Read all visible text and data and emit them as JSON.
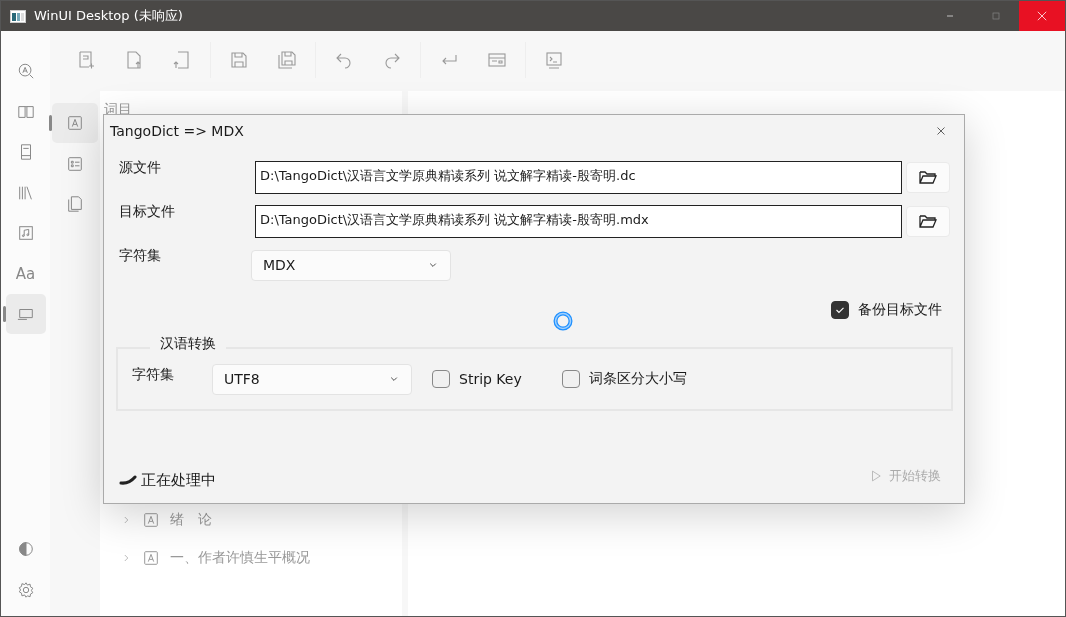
{
  "window": {
    "title": "WinUI Desktop (未响应)"
  },
  "rail": {
    "top": [
      {
        "kind": "search",
        "selected": false
      },
      {
        "kind": "book",
        "selected": false
      },
      {
        "kind": "notebook",
        "selected": false
      },
      {
        "kind": "library",
        "selected": false
      },
      {
        "kind": "music",
        "selected": false
      },
      {
        "kind": "text",
        "label": "Aa",
        "selected": false
      },
      {
        "kind": "device",
        "selected": true
      }
    ],
    "bottom": [
      {
        "kind": "contrast"
      },
      {
        "kind": "settings"
      }
    ]
  },
  "subrail": [
    {
      "kind": "letter",
      "selected": true
    },
    {
      "kind": "list",
      "selected": false
    },
    {
      "kind": "copy",
      "selected": false
    }
  ],
  "toolbar": [
    [
      {
        "kind": "new"
      },
      {
        "kind": "export"
      },
      {
        "kind": "import"
      }
    ],
    [
      {
        "kind": "save"
      },
      {
        "kind": "save-all"
      }
    ],
    [
      {
        "kind": "undo"
      },
      {
        "kind": "redo"
      }
    ],
    [
      {
        "kind": "enter"
      },
      {
        "kind": "form"
      }
    ],
    [
      {
        "kind": "terminal"
      }
    ]
  ],
  "tree": {
    "header": "词目",
    "items": [
      {
        "label": "绪　论",
        "expanded": false
      },
      {
        "label": "一、作者许慎生平概况",
        "expanded": false
      }
    ]
  },
  "dialog": {
    "title": "TangoDict => MDX",
    "source": {
      "label": "源文件",
      "value": "D:\\TangoDict\\汉语言文学原典精读系列 说文解字精读-殷寄明.dc"
    },
    "target": {
      "label": "目标文件",
      "value": "D:\\TangoDict\\汉语言文学原典精读系列 说文解字精读-殷寄明.mdx"
    },
    "charset": {
      "label": "字符集",
      "value": "MDX"
    },
    "busy": true,
    "backup": {
      "label": "备份目标文件",
      "checked": true
    },
    "group": {
      "title": "汉语转换",
      "charset": {
        "label": "字符集",
        "value": "UTF8"
      },
      "options": [
        {
          "label": "Strip Key",
          "checked": false
        },
        {
          "label": "词条区分大小写",
          "checked": false
        }
      ]
    },
    "status": "正在处理中",
    "start": {
      "label": "开始转换",
      "disabled": true
    }
  }
}
